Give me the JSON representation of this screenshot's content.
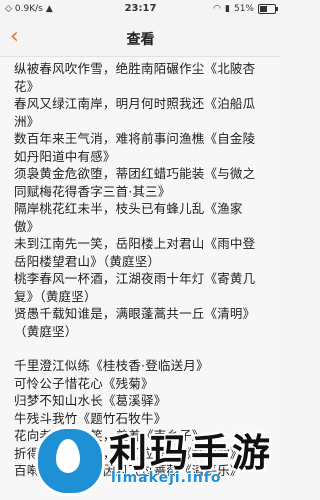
{
  "statusbar": {
    "speed": "0.9K/s",
    "time": "23:17",
    "battery": "51%",
    "battery_level": 0.51
  },
  "navbar": {
    "back_icon": "chevron-left-icon",
    "title": "查看"
  },
  "poem_part1": "纵被春风吹作雪，绝胜南陌碾作尘《北陂杏花》\n春风又绿江南岸，明月何时照我还《泊船瓜洲》\n数百年来王气消，难将前事问渔樵《自金陵如丹阳道中有感》\n须袅黄金危欲堕，蒂团红蜡巧能装《与微之同赋梅花得香字三首·其三》\n隔岸桃花红未半，枝头已有蜂儿乱《渔家傲》\n未到江南先一笑，岳阳楼上对君山《雨中登岳阳楼望君山》（黄庭坚）\n桃李春风一杯酒，江湖夜雨十年灯《寄黄几复》（黄庭坚）\n贤愚千载知谁是，满眼蓬蒿共一丘《清明》（黄庭坚）",
  "poem_part2": "千里澄江似练《桂枝香·登临送月》\n可怜公子惜花心《残菊》\n归梦不知山水长《葛溪驿》\n牛残斗我竹《题竹石牧牛》\n花向老人头上笑，羞羞《南乡子》\n折得一枝香在手，人间应未有《甘露歌》\n百啭无人能解，因风飞过蔷薇《清平乐》",
  "watermark": {
    "text": "利玛手游",
    "url": "limakeji.info"
  }
}
